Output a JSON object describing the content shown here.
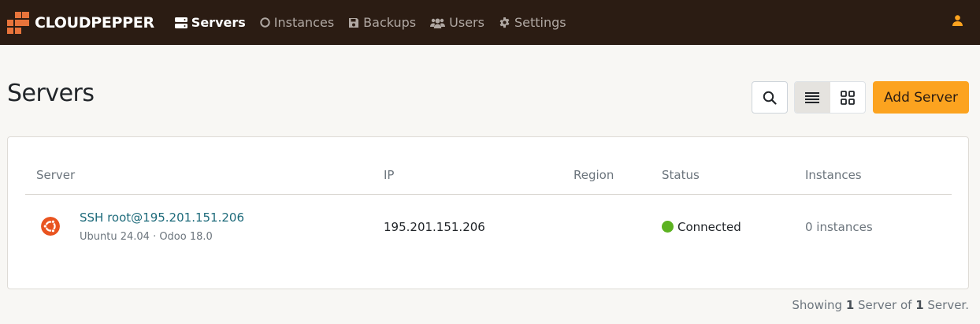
{
  "brand": {
    "name": "CLOUDPEPPER"
  },
  "colors": {
    "topbar": "#2b1c13",
    "accent": "#fca31f",
    "logo": "#e8743b",
    "link": "#1e6b7b",
    "status_ok": "#5cb221"
  },
  "nav": {
    "items": [
      {
        "label": "Servers",
        "icon": "server-icon",
        "active": true
      },
      {
        "label": "Instances",
        "icon": "circle-icon",
        "active": false
      },
      {
        "label": "Backups",
        "icon": "floppy-disk-icon",
        "active": false
      },
      {
        "label": "Users",
        "icon": "users-icon",
        "active": false
      },
      {
        "label": "Settings",
        "icon": "gear-icon",
        "active": false
      }
    ],
    "user_icon": "user-icon"
  },
  "page": {
    "title": "Servers"
  },
  "toolbar": {
    "add_label": "Add Server",
    "search_icon": "search-icon",
    "list_icon": "list-view-icon",
    "grid_icon": "grid-view-icon"
  },
  "table": {
    "columns": [
      "Server",
      "IP",
      "Region",
      "Status",
      "Instances"
    ],
    "rows": [
      {
        "name": "SSH root@195.201.151.206",
        "subtitle": "Ubuntu 24.04 · Odoo 18.0",
        "os_icon": "ubuntu-icon",
        "ip": "195.201.151.206",
        "region": "",
        "status": "Connected",
        "instances": "0 instances"
      }
    ]
  },
  "footer": {
    "prefix": "Showing ",
    "shown": "1",
    "middle": " Server of ",
    "total": "1",
    "suffix": " Server."
  }
}
